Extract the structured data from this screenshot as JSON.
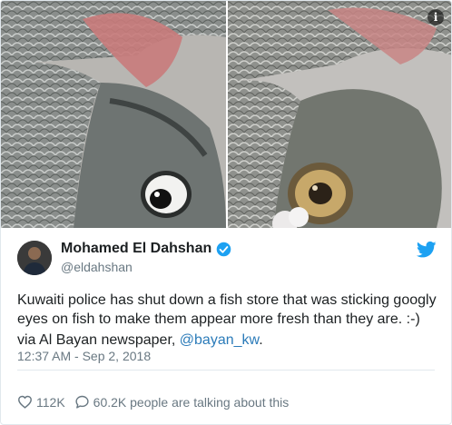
{
  "media": {
    "left_image": "fish-with-googly-eye",
    "right_image": "fish-with-real-eye",
    "info_icon_glyph": "i"
  },
  "tweet": {
    "display_name": "Mohamed El Dahshan",
    "handle": "@eldahshan",
    "text_line1": "Kuwaiti police has shut down a fish store that was sticking googly eyes on fish to make them appear more fresh than they are. :-)",
    "text_line2_prefix": "via Al Bayan newspaper, ",
    "text_line2_link": "@bayan_kw",
    "text_line2_suffix": ".",
    "timestamp": "12:37 AM - Sep 2, 2018",
    "likes": "112K",
    "replies_text": "60.2K people are talking about this"
  },
  "colors": {
    "link": "#2b7bb9",
    "twitter_blue": "#1da1f2",
    "muted": "#697882",
    "text": "#1c2022"
  }
}
